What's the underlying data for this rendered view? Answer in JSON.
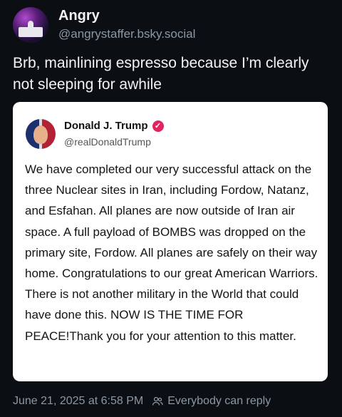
{
  "author": {
    "display_name": "Angry",
    "handle": "@angrystaffer.bsky.social",
    "avatar_icon": "white-house-fireworks-avatar"
  },
  "post": {
    "text": "Brb, mainlining espresso because I’m clearly not sleeping for awhile"
  },
  "embed": {
    "display_name": "Donald J. Trump",
    "handle": "@realDonaldTrump",
    "verified_badge_color": "#e0245e",
    "body": "We have completed our very successful attack on the three Nuclear sites in Iran, including Fordow, Natanz, and Esfahan. All planes are now outside of Iran air space. A full payload of BOMBS was dropped on the primary site, Fordow. All planes are safely on their way home. Congratulations to our great American Warriors. There is not another military in the World that could have done this. NOW IS THE TIME FOR PEACE!Thank you for your attention to this matter."
  },
  "footer": {
    "timestamp": "June 21, 2025 at 6:58 PM",
    "reply_setting": "Everybody can reply",
    "reply_icon": "people-icon"
  }
}
